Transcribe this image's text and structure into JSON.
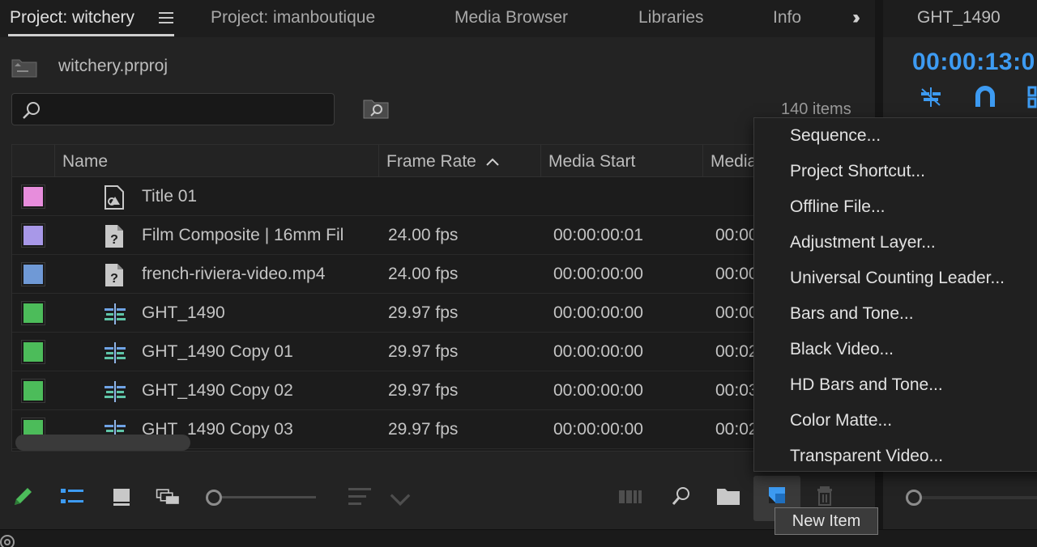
{
  "tabs": [
    {
      "label": "Project: witchery",
      "active": true
    },
    {
      "label": "Project: imanboutique"
    },
    {
      "label": "Media Browser"
    },
    {
      "label": "Libraries"
    },
    {
      "label": "Info"
    }
  ],
  "breadcrumb": {
    "file": "witchery.prproj",
    "icon": "folder-up-icon"
  },
  "search": {
    "value": "",
    "placeholder": ""
  },
  "item_count": "140 items",
  "table": {
    "columns": [
      "Name",
      "Frame Rate",
      "Media Start",
      "Media"
    ],
    "sort_column": "Frame Rate",
    "sort_direction": "ascending",
    "rows": [
      {
        "color": "#e78ddc",
        "icon": "graphic-file-icon",
        "name": "Title 01",
        "frame_rate": "",
        "media_start": "",
        "media_end": ""
      },
      {
        "color": "#a898e8",
        "icon": "missing-file-icon",
        "name": "Film Composite | 16mm Fil",
        "frame_rate": "24.00 fps",
        "media_start": "00:00:00:01",
        "media_end": "00:00"
      },
      {
        "color": "#6f99d6",
        "icon": "missing-file-icon",
        "name": "french-riviera-video.mp4",
        "frame_rate": "24.00 fps",
        "media_start": "00:00:00:00",
        "media_end": "00:00"
      },
      {
        "color": "#4cbc5a",
        "icon": "sequence-icon",
        "name": "GHT_1490",
        "frame_rate": "29.97 fps",
        "media_start": "00:00:00:00",
        "media_end": "00:00"
      },
      {
        "color": "#4cbc5a",
        "icon": "sequence-icon",
        "name": "GHT_1490 Copy 01",
        "frame_rate": "29.97 fps",
        "media_start": "00:00:00:00",
        "media_end": "00:02"
      },
      {
        "color": "#4cbc5a",
        "icon": "sequence-icon",
        "name": "GHT_1490 Copy 02",
        "frame_rate": "29.97 fps",
        "media_start": "00:00:00:00",
        "media_end": "00:03"
      },
      {
        "color": "#4cbc5a",
        "icon": "sequence-icon",
        "name": "GHT_1490 Copy 03",
        "frame_rate": "29.97 fps",
        "media_start": "00:00:00:00",
        "media_end": "00:02"
      }
    ]
  },
  "program_monitor": {
    "title": "GHT_1490",
    "timecode": "00:00:13:0"
  },
  "new_item_menu": {
    "items": [
      "Sequence...",
      "Project Shortcut...",
      "Offline File...",
      "Adjustment Layer...",
      "Universal Counting Leader...",
      "Bars and Tone...",
      "Black Video...",
      "HD Bars and Tone...",
      "Color Matte...",
      "Transparent Video..."
    ]
  },
  "tooltip": "New Item",
  "colors": {
    "accent": "#3d9bf2",
    "pencil": "#4cbc5a"
  }
}
